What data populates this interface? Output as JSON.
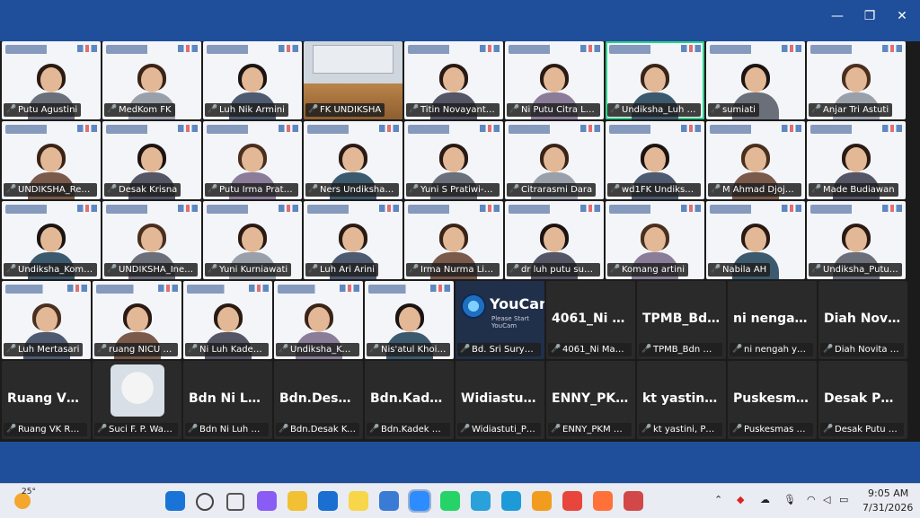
{
  "window": {
    "minimize": "—",
    "restore": "❐",
    "close": "✕"
  },
  "rows": [
    [
      {
        "name": "Putu Agustini",
        "type": "bg",
        "w": 112
      },
      {
        "name": "MedKom FK",
        "type": "bg",
        "w": 112
      },
      {
        "name": "Luh Nik Armini",
        "type": "bg",
        "w": 112
      },
      {
        "name": "FK UNDIKSHA",
        "type": "room",
        "w": 112
      },
      {
        "name": "Titin Novayanti Dey",
        "type": "bg",
        "w": 112
      },
      {
        "name": "Ni Putu Citra Laksmi",
        "type": "bg",
        "w": 112
      },
      {
        "name": "Undiksha_Luh Yenny A...",
        "type": "bg",
        "w": 112,
        "active": true
      },
      {
        "name": "sumiati",
        "type": "bg",
        "w": 112
      },
      {
        "name": "Anjar Tri Astuti",
        "type": "bg",
        "w": 112
      }
    ],
    [
      {
        "name": "UNDIKSHA_Regina ...",
        "type": "bg",
        "w": 112
      },
      {
        "name": "Desak Krisna",
        "type": "bg",
        "w": 112
      },
      {
        "name": "Putu Irma Pratiwi",
        "type": "bg",
        "w": 112
      },
      {
        "name": "Ners Undiksha - Ns...",
        "type": "bg",
        "w": 112
      },
      {
        "name": "Yuni S Pratiwi-FK U...",
        "type": "bg",
        "w": 112
      },
      {
        "name": "Citrarasmi Dara",
        "type": "bg",
        "w": 112
      },
      {
        "name": "wd1FK Undiksha p...",
        "type": "bg",
        "w": 112
      },
      {
        "name": "M Ahmad Djojosug...",
        "type": "bg",
        "w": 112
      },
      {
        "name": "Made Budiawan",
        "type": "bg",
        "w": 112
      }
    ],
    [
      {
        "name": "Undiksha_Komang ...",
        "type": "bg",
        "w": 112
      },
      {
        "name": "UNDIKSHA_Ineke P...",
        "type": "bg",
        "w": 112
      },
      {
        "name": "Yuni Kurniawati",
        "type": "bg",
        "w": 112
      },
      {
        "name": "Luh Ari Arini",
        "type": "bg",
        "w": 112
      },
      {
        "name": "Irma Nurma Linda",
        "type": "bg",
        "w": 112
      },
      {
        "name": "dr luh putu suartini...",
        "type": "bg",
        "w": 112
      },
      {
        "name": "Komang artini",
        "type": "bg",
        "w": 112
      },
      {
        "name": "Nabila AH",
        "type": "bg",
        "w": 112
      },
      {
        "name": "Undiksha_Putu Eva ...",
        "type": "bg",
        "w": 112
      }
    ],
    [
      {
        "name": "Luh Mertasari",
        "type": "bg",
        "w": 101
      },
      {
        "name": "ruang NICU RSU...",
        "type": "bg",
        "w": 101
      },
      {
        "name": "Ni Luh Kadek Ali...",
        "type": "bg",
        "w": 101
      },
      {
        "name": "Undiksha_Ketut ...",
        "type": "bg",
        "w": 101
      },
      {
        "name": "Nis'atul Khoiroh",
        "type": "bg",
        "w": 101
      },
      {
        "name": "Bd. Sri Suryati, S...",
        "type": "cam",
        "w": 101,
        "big": "YouCam",
        "sub": "Please Start YouCam"
      },
      {
        "name": "4061_Ni Made Y...",
        "type": "dark",
        "w": 101,
        "big": "4061_Ni Ma..."
      },
      {
        "name": "TPMB_Bdn Desa...",
        "type": "dark",
        "w": 101,
        "big": "TPMB_Bdn..."
      },
      {
        "name": "ni nengah yunar...",
        "type": "dark",
        "w": 101,
        "big": "ni nengah y..."
      },
      {
        "name": "Diah Novita _Pus...",
        "type": "dark",
        "w": 101,
        "big": "Diah Novit..."
      }
    ],
    [
      {
        "name": "Ruang VK RSUD ...",
        "type": "dark",
        "w": 101,
        "big": "Ruang VK R..."
      },
      {
        "name": "Suci F. P. Wardani",
        "type": "dark",
        "w": 101,
        "cat": true
      },
      {
        "name": "Bdn Ni Luh Mari...",
        "type": "dark",
        "w": 101,
        "big": "Bdn Ni Luh..."
      },
      {
        "name": "Bdn.Desak Ketut ...",
        "type": "dark",
        "w": 101,
        "big": "Bdn.Desak..."
      },
      {
        "name": "Bdn.Kadek Krisn...",
        "type": "dark",
        "w": 101,
        "big": "Bdn.Kadek..."
      },
      {
        "name": "Widiastuti_Pusk...",
        "type": "dark",
        "w": 101,
        "big": "Widiastuti_..."
      },
      {
        "name": "ENNY_PKM KBT 1",
        "type": "dark",
        "w": 101,
        "big": "ENNY_PKM..."
      },
      {
        "name": "kt yastini, Puskes...",
        "type": "dark",
        "w": 101,
        "big": "kt yastini, P..."
      },
      {
        "name": "Puskesmas Bulel...",
        "type": "dark",
        "w": 101,
        "big": "Puskesmas..."
      },
      {
        "name": "Desak Putu Tirta ...",
        "type": "dark",
        "w": 101,
        "big": "Desak Putu..."
      }
    ]
  ],
  "taskbar": {
    "weather_temp": "25°",
    "apps": [
      "start",
      "search",
      "task-view",
      "copilot",
      "file-explorer",
      "outlook",
      "sticky-notes",
      "notepad",
      "zoom",
      "whatsapp",
      "telegram",
      "edge",
      "c-app",
      "chrome",
      "firefox",
      "chrome-profile"
    ],
    "time": "9:05 AM",
    "date": "7/31/2026"
  }
}
